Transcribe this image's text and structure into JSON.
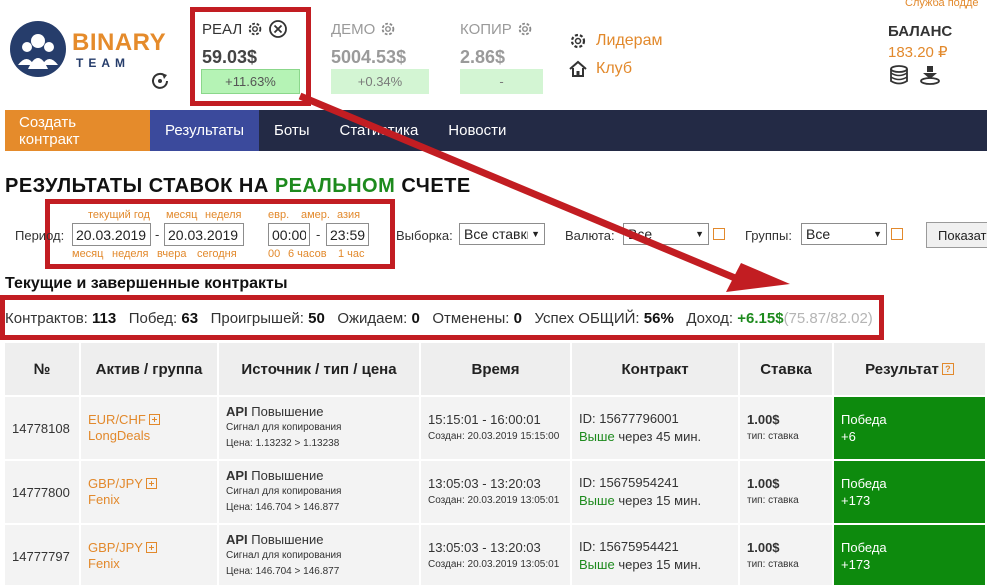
{
  "header": {
    "support_link": "Служба подде",
    "logo": {
      "word": "BINARY",
      "sub": "TEAM"
    },
    "accounts": [
      {
        "name": "РЕАЛ",
        "amount": "59.03$",
        "change": "+11.63%"
      },
      {
        "name": "ДЕМО",
        "amount": "5004.53$",
        "change": "+0.34%"
      },
      {
        "name": "КОПИР",
        "amount": "2.86$",
        "change": "-"
      }
    ],
    "links": {
      "leaders": "Лидерам",
      "club": "Клуб"
    },
    "balance": {
      "label": "БАЛАНС",
      "value": "183.20 ₽"
    }
  },
  "menu": {
    "create": "Создать контракт",
    "results": "Результаты",
    "bots": "Боты",
    "stats": "Статистика",
    "news": "Новости"
  },
  "page": {
    "title_pre": "РЕЗУЛЬТАТЫ СТАВОК НА ",
    "title_green": "РЕАЛЬНОМ",
    "title_post": " СЧЕТЕ"
  },
  "filters": {
    "period_label": "Период:",
    "top_hints": {
      "current_year": "текущий год",
      "month": "месяц",
      "week": "неделя",
      "eur": "евр.",
      "amer": "амер.",
      "asia": "азия"
    },
    "bottom_hints": {
      "month": "месяц",
      "week": "неделя",
      "yesterday": "вчера",
      "today": "сегодня",
      "zero": "00",
      "six_hours": "6 часов",
      "one_hour": "1 час"
    },
    "date_from": "20.03.2019",
    "date_to": "20.03.2019",
    "time_from": "00:00",
    "time_to": "23:59",
    "selection_label": "Выборка:",
    "selection_value": "Все ставки",
    "currency_label": "Валюта:",
    "currency_value": "Все",
    "groups_label": "Группы:",
    "groups_value": "Все",
    "show_button": "Показать"
  },
  "section_title": "Текущие и завершенные контракты",
  "stats": {
    "contracts_label": "Контрактов:",
    "contracts": "113",
    "wins_label": "Побед:",
    "wins": "63",
    "losses_label": "Проигрышей:",
    "losses": "50",
    "waiting_label": "Ожидаем:",
    "waiting": "0",
    "cancelled_label": "Отменены:",
    "cancelled": "0",
    "success_label": "Успех ОБЩИЙ:",
    "success": "56%",
    "income_label": "Доход:",
    "income": "+6.15$",
    "extra": "(75.87/82.02)"
  },
  "table": {
    "headers": [
      "№",
      "Актив / группа",
      "Источник / тип / цена",
      "Время",
      "Контракт",
      "Ставка",
      "Результат"
    ],
    "rows": [
      {
        "id": "14778108",
        "asset": "EUR/CHF",
        "group": "LongDeals",
        "source": "API",
        "type": "Повышение",
        "signal": "Сигнал для копирования",
        "price": "Цена: 1.13232 > 1.13238",
        "time": "15:15:01 - 16:00:01",
        "created": "Создан: 20.03.2019 15:15:00",
        "contract_id": "ID: 15677796001",
        "direction": "Выше",
        "duration": "через 45 мин.",
        "stake": "1.00$",
        "stake_type": "тип: ставка",
        "result": "Победа",
        "result_value": "+6"
      },
      {
        "id": "14777800",
        "asset": "GBP/JPY",
        "group": "Fenix",
        "source": "API",
        "type": "Повышение",
        "signal": "Сигнал для копирования",
        "price": "Цена: 146.704 > 146.877",
        "time": "13:05:03 - 13:20:03",
        "created": "Создан: 20.03.2019 13:05:01",
        "contract_id": "ID: 15675954241",
        "direction": "Выше",
        "duration": "через 15 мин.",
        "stake": "1.00$",
        "stake_type": "тип: ставка",
        "result": "Победа",
        "result_value": "+173"
      },
      {
        "id": "14777797",
        "asset": "GBP/JPY",
        "group": "Fenix",
        "source": "API",
        "type": "Повышение",
        "signal": "Сигнал для копирования",
        "price": "Цена: 146.704 > 146.877",
        "time": "13:05:03 - 13:20:03",
        "created": "Создан: 20.03.2019 13:05:01",
        "contract_id": "ID: 15675954421",
        "direction": "Выше",
        "duration": "через 15 мин.",
        "stake": "1.00$",
        "stake_type": "тип: ставка",
        "result": "Победа",
        "result_value": "+173"
      }
    ]
  },
  "colors": {
    "accent_orange": "#e58b2b",
    "nav_dark": "#232a45",
    "nav_active": "#3b4a9c",
    "win_green": "#0d8a0d",
    "annotation_red": "#c21d22"
  }
}
